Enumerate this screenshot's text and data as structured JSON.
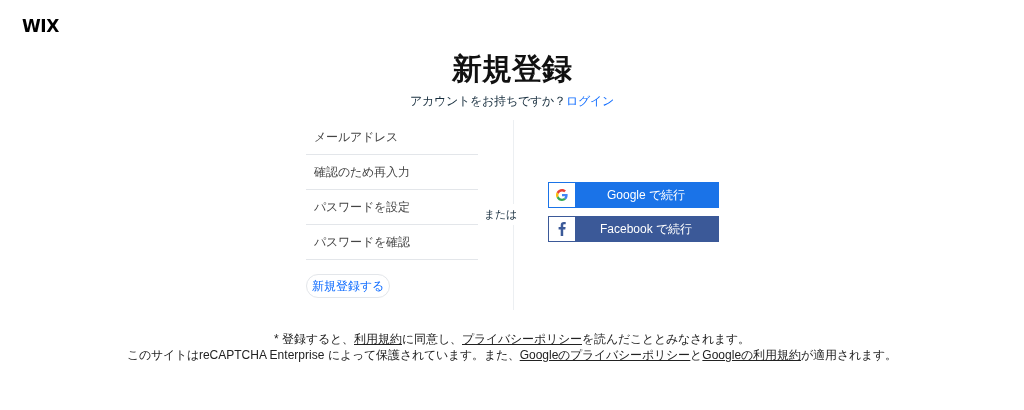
{
  "logo": "WIX",
  "title": "新規登録",
  "subtitle": {
    "text": "アカウントをお持ちですか？",
    "link": "ログイン"
  },
  "fields": [
    {
      "placeholder": "メールアドレス"
    },
    {
      "placeholder": "確認のため再入力"
    },
    {
      "placeholder": "パスワードを設定"
    },
    {
      "placeholder": "パスワードを確認"
    }
  ],
  "submit": "新規登録する",
  "divider_label": "または",
  "social_buttons": [
    {
      "kind": "google",
      "label": "Google で続行",
      "color": "#1a73e8"
    },
    {
      "kind": "facebook",
      "label": "Facebook で続行",
      "color": "#3b5998"
    }
  ],
  "footer": [
    [
      {
        "kind": "text",
        "text": "* 登録すると、"
      },
      {
        "kind": "link",
        "text": "利用規約"
      },
      {
        "kind": "text",
        "text": "に同意し、"
      },
      {
        "kind": "link",
        "text": "プライバシーポリシー"
      },
      {
        "kind": "text",
        "text": "を読んだこととみなされます。"
      }
    ],
    [
      {
        "kind": "text",
        "text": "このサイトはreCAPTCHA Enterprise によって保護されています。また、"
      },
      {
        "kind": "link",
        "text": "Googleのプライバシーポリシー"
      },
      {
        "kind": "text",
        "text": "と"
      },
      {
        "kind": "link",
        "text": "Googleの利用規約"
      },
      {
        "kind": "text",
        "text": "が適用されます。"
      }
    ]
  ]
}
